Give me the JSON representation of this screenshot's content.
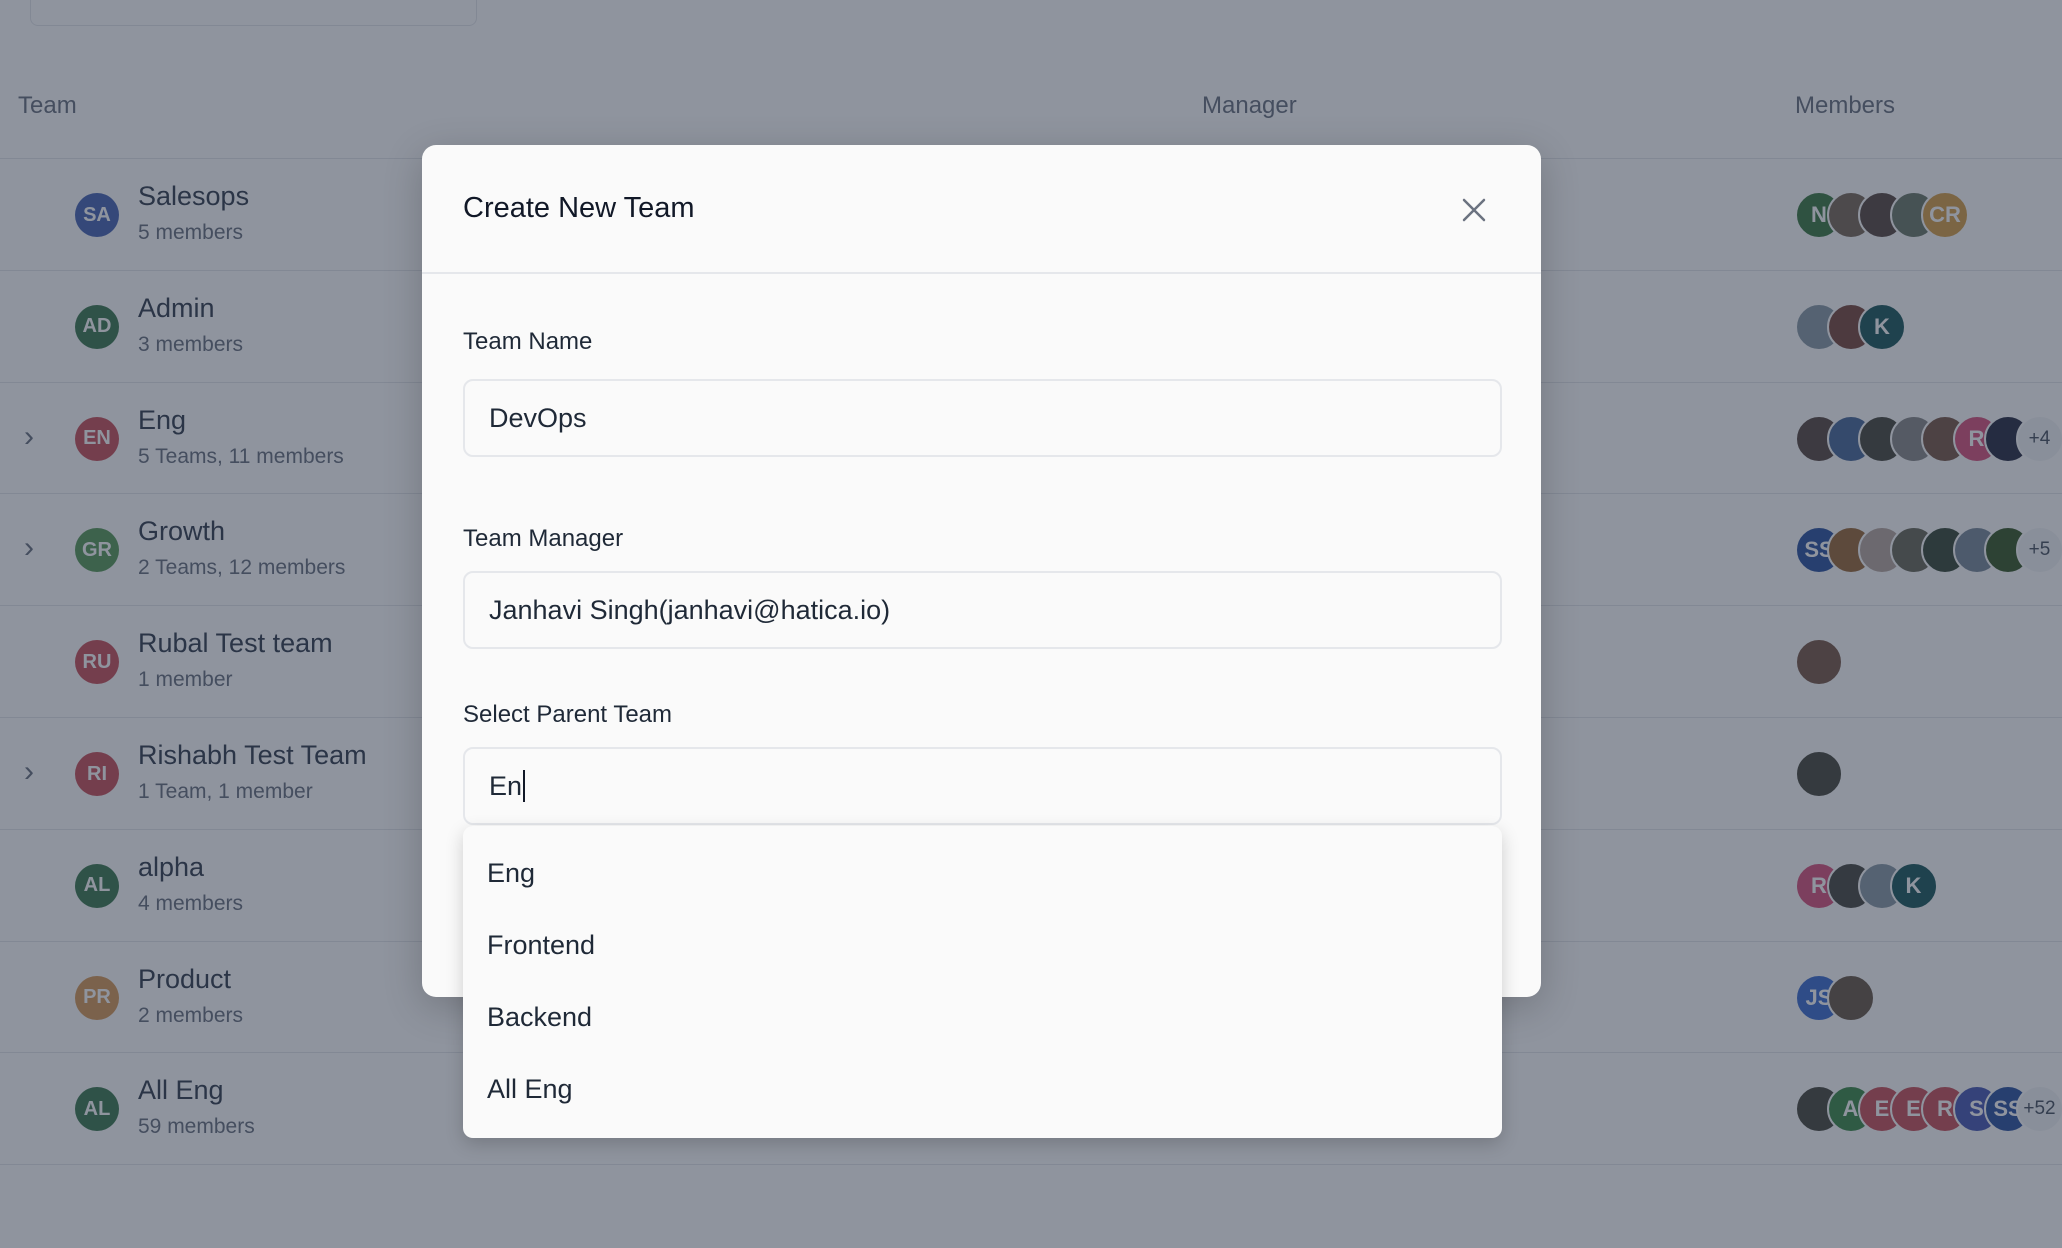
{
  "table": {
    "headers": {
      "team": "Team",
      "manager": "Manager",
      "members": "Members"
    },
    "rows": [
      {
        "initials": "SA",
        "color": "#4a67b5",
        "name": "Salesops",
        "sub": "5 members",
        "expandable": false,
        "members": [
          {
            "t": "N",
            "c": "#3f7a45"
          },
          {
            "t": "",
            "c": "#7a6a5a"
          },
          {
            "t": "",
            "c": "#5a4a44"
          },
          {
            "t": "",
            "c": "#6d7a6a"
          },
          {
            "t": "CR",
            "c": "#d6a04a"
          }
        ]
      },
      {
        "initials": "AD",
        "color": "#3f7a52",
        "name": "Admin",
        "sub": "3 members",
        "expandable": false,
        "members": [
          {
            "t": "",
            "c": "#8a9aa6"
          },
          {
            "t": "",
            "c": "#7a4a40"
          },
          {
            "t": "K",
            "c": "#1f5a5e"
          }
        ]
      },
      {
        "initials": "EN",
        "color": "#c9535c",
        "name": "Eng",
        "sub": "5 Teams, 11 members",
        "expandable": true,
        "members": [
          {
            "t": "",
            "c": "#5a4a44"
          },
          {
            "t": "",
            "c": "#4a6a9a"
          },
          {
            "t": "",
            "c": "#4a4a40"
          },
          {
            "t": "",
            "c": "#8a8a8a"
          },
          {
            "t": "",
            "c": "#7a5a4a"
          },
          {
            "t": "R",
            "c": "#d8557e"
          },
          {
            "t": "",
            "c": "#2a2e44"
          },
          {
            "t": "+4",
            "c": "more"
          }
        ]
      },
      {
        "initials": "GR",
        "color": "#5a9a5a",
        "name": "Growth",
        "sub": "2 Teams, 12 members",
        "expandable": true,
        "members": [
          {
            "t": "SS",
            "c": "#2f55a0"
          },
          {
            "t": "",
            "c": "#9a6a3a"
          },
          {
            "t": "",
            "c": "#b8a8a0"
          },
          {
            "t": "",
            "c": "#6a6a5a"
          },
          {
            "t": "",
            "c": "#3a4a3a"
          },
          {
            "t": "",
            "c": "#7a8a9a"
          },
          {
            "t": "",
            "c": "#3a5a2a"
          },
          {
            "t": "+5",
            "c": "more"
          }
        ]
      },
      {
        "initials": "RU",
        "color": "#c9535c",
        "name": "Rubal Test team",
        "sub": "1 member",
        "expandable": false,
        "members": [
          {
            "t": "",
            "c": "#7a5a4a"
          }
        ]
      },
      {
        "initials": "RI",
        "color": "#c9535c",
        "name": "Rishabh Test Team",
        "sub": "1 Team, 1 member",
        "expandable": true,
        "members": [
          {
            "t": "",
            "c": "#4a4a40"
          }
        ]
      },
      {
        "initials": "AL",
        "color": "#3f7a52",
        "name": "alpha",
        "sub": "4 members",
        "expandable": false,
        "members": [
          {
            "t": "R",
            "c": "#d8557e"
          },
          {
            "t": "",
            "c": "#4a4a44"
          },
          {
            "t": "",
            "c": "#8a9aa6"
          },
          {
            "t": "K",
            "c": "#1f5a5e"
          }
        ]
      },
      {
        "initials": "PR",
        "color": "#d69a5a",
        "name": "Product",
        "sub": "2 members",
        "expandable": false,
        "members": [
          {
            "t": "JS",
            "c": "#3f6fd0"
          },
          {
            "t": "",
            "c": "#6a5a4a"
          }
        ]
      },
      {
        "initials": "AL",
        "color": "#3f7a52",
        "name": "All Eng",
        "sub": "59 members",
        "expandable": false,
        "members": [
          {
            "t": "",
            "c": "#4a4a40"
          },
          {
            "t": "A",
            "c": "#3f8a4a"
          },
          {
            "t": "E",
            "c": "#c9535c"
          },
          {
            "t": "E",
            "c": "#c9535c"
          },
          {
            "t": "R",
            "c": "#c9535c"
          },
          {
            "t": "S",
            "c": "#4a5ab5"
          },
          {
            "t": "SS",
            "c": "#2f55a0"
          },
          {
            "t": "+52",
            "c": "more"
          }
        ]
      }
    ]
  },
  "modal": {
    "title": "Create New Team",
    "team_name_label": "Team Name",
    "team_name_value": "DevOps",
    "manager_label": "Team Manager",
    "manager_value": "Janhavi Singh(janhavi@hatica.io)",
    "parent_label": "Select Parent Team",
    "parent_value": "En",
    "options": [
      "Eng",
      "Frontend",
      "Backend",
      "All Eng"
    ]
  }
}
